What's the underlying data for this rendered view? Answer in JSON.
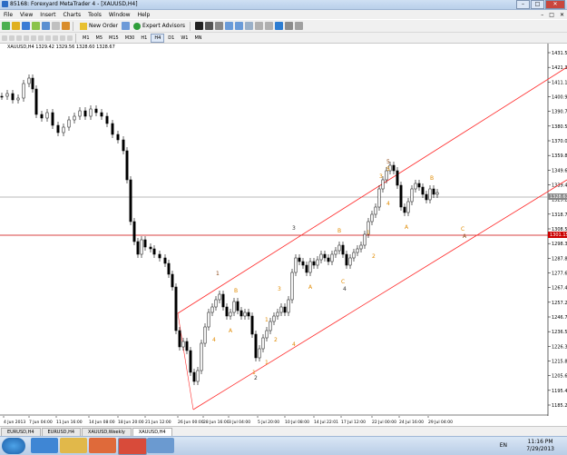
{
  "window": {
    "title": "85168: Forexyard MetaTrader 4 - [XAUUSD,H4]",
    "min": "–",
    "max": "□",
    "close": "✕"
  },
  "menu": [
    "File",
    "View",
    "Insert",
    "Charts",
    "Tools",
    "Window",
    "Help"
  ],
  "mdi_buttons": [
    "–",
    "□",
    "✕"
  ],
  "toolbar": {
    "new_order": "New Order",
    "expert_advisors": "Expert Advisors"
  },
  "timeframes": [
    "M1",
    "M5",
    "M15",
    "M30",
    "H1",
    "H4",
    "D1",
    "W1",
    "MN"
  ],
  "active_timeframe": "H4",
  "chart": {
    "header": "XAUUSD,H4  1329.42 1329.56 1328.60 1328.67",
    "price_ticks": [
      "1431.50",
      "1421.30",
      "1411.10",
      "1400.90",
      "1390.70",
      "1380.50",
      "1370.00",
      "1359.80",
      "1349.60",
      "1339.40",
      "1329.20",
      "1318.70",
      "1308.50",
      "1298.30",
      "1287.80",
      "1277.60",
      "1267.40",
      "1257.20",
      "1246.70",
      "1236.50",
      "1226.30",
      "1215.80",
      "1205.60",
      "1195.40",
      "1185.20"
    ],
    "current_price_label": "1328.67",
    "hline_label": "1301.15",
    "time_ticks": [
      "4 Jun 2013",
      "7 Jun 04:00",
      "11 Jun 16:00",
      "14 Jun 08:00",
      "18 Jun 20:00",
      "21 Jun 12:00",
      "26 Jun 00:00",
      "28 Jun 16:00",
      "3 Jul 04:00",
      "5 Jul 20:00",
      "10 Jul 08:00",
      "14 Jul 22:01",
      "17 Jul 12:00",
      "22 Jul 00:00",
      "24 Jul 16:00",
      "29 Jul 04:00"
    ],
    "wave_labels": [
      {
        "t": "1",
        "color": "#8b4513"
      },
      {
        "t": "4",
        "color": "#e08a00"
      },
      {
        "t": "B",
        "color": "#e08a00"
      },
      {
        "t": "A",
        "color": "#e08a00"
      },
      {
        "t": "2",
        "color": "#333333"
      },
      {
        "t": "1",
        "color": "#e08a00"
      },
      {
        "t": "2",
        "color": "#e08a00"
      },
      {
        "t": "3",
        "color": "#e08a00"
      },
      {
        "t": "4",
        "color": "#e08a00"
      },
      {
        "t": "3",
        "color": "#333333"
      },
      {
        "t": "A",
        "color": "#e08a00"
      },
      {
        "t": "B",
        "color": "#e08a00"
      },
      {
        "t": "C",
        "color": "#e08a00"
      },
      {
        "t": "4",
        "color": "#333333"
      },
      {
        "t": "2",
        "color": "#e08a00"
      },
      {
        "t": "1",
        "color": "#e08a00"
      },
      {
        "t": "5",
        "color": "#8b4513"
      },
      {
        "t": "5",
        "color": "#e08a00"
      },
      {
        "t": "3",
        "color": "#e08a00"
      },
      {
        "t": "4",
        "color": "#e08a00"
      },
      {
        "t": "A",
        "color": "#e08a00"
      },
      {
        "t": "B",
        "color": "#e08a00"
      },
      {
        "t": "C",
        "color": "#e08a00"
      },
      {
        "t": "A",
        "color": "#8b4513"
      },
      {
        "t": "1",
        "color": "#e08a00"
      },
      {
        "t": "1",
        "color": "#e08a00"
      }
    ],
    "colors": {
      "channel": "#ff2a2a",
      "hline": "#cc0000",
      "current": "#a0a0a0",
      "candle": "#000000",
      "wave": "#e08a00"
    }
  },
  "chart_tabs": [
    "EURUSD,H4",
    "EURUSD,H4",
    "XAUUSD,Weekly",
    "XAUUSD,H4"
  ],
  "active_chart_tab": "XAUUSD,H4",
  "taskbar": {
    "lang": "EN",
    "time": "11:16 PM",
    "date": "7/29/2013"
  }
}
